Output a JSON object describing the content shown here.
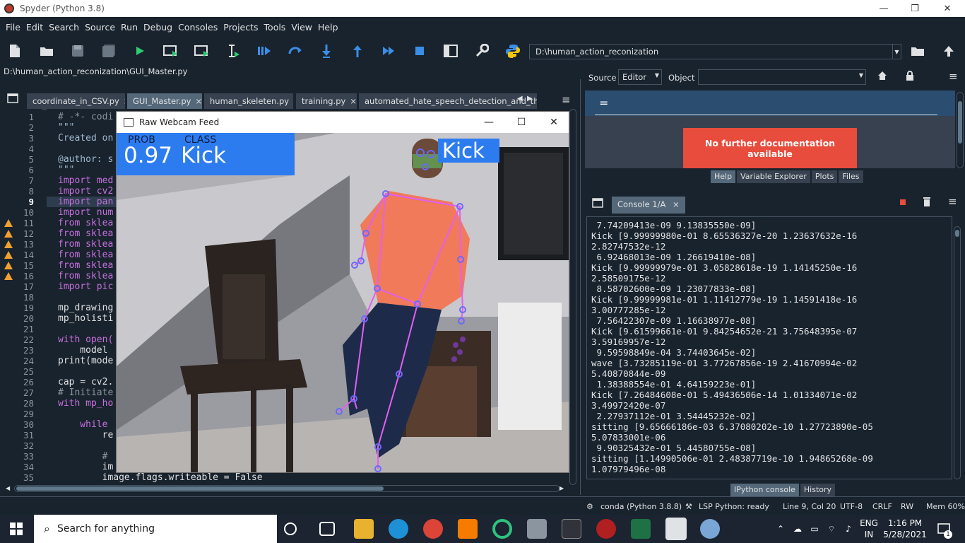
{
  "window": {
    "title": "Spyder (Python 3.8)"
  },
  "menu": [
    "File",
    "Edit",
    "Search",
    "Source",
    "Run",
    "Debug",
    "Consoles",
    "Projects",
    "Tools",
    "View",
    "Help"
  ],
  "toolbar": {
    "path_value": "D:\\human_action_reconization",
    "icons": [
      "new-file-icon",
      "open-folder-icon",
      "save-icon",
      "save-all-icon",
      "run-icon",
      "run-cell-icon",
      "run-cell-advance-icon",
      "run-selection-icon",
      "debug-icon",
      "step-icon",
      "step-into-icon",
      "step-return-icon",
      "continue-icon",
      "stop-icon",
      "maximize-pane-icon",
      "preferences-icon",
      "python-path-icon"
    ]
  },
  "editor": {
    "file_path": "D:\\human_action_reconization\\GUI_Master.py",
    "tabs": [
      {
        "label": "coordinate_in_CSV.py",
        "close": "×"
      },
      {
        "label": "GUI_Master.py",
        "close": "×"
      },
      {
        "label": "human_skeleten.py",
        "close": "×"
      },
      {
        "label": "training.py",
        "close": "×"
      },
      {
        "label": "automated_hate_speech_detection_and_the_prob",
        "close": ""
      }
    ],
    "line_numbers": [
      "1",
      "2",
      "3",
      "4",
      "5",
      "6",
      "7",
      "8",
      "9",
      "10",
      "11",
      "12",
      "13",
      "14",
      "15",
      "16",
      "17",
      "18",
      "19",
      "20",
      "21",
      "22",
      "23",
      "24",
      "25",
      "26",
      "27",
      "28",
      "29",
      "30",
      "31",
      "32",
      "33",
      "34",
      "35"
    ],
    "current_line": "9",
    "code_lines": [
      {
        "n": 1,
        "text": "# -*- codi",
        "color": "#8a95a0"
      },
      {
        "n": 2,
        "text": "\"\"\"",
        "color": "#9fb8cf"
      },
      {
        "n": 3,
        "text": "Created on",
        "color": "#9fb8cf"
      },
      {
        "n": 5,
        "text": "@author: s",
        "color": "#9fb8cf"
      },
      {
        "n": 6,
        "text": "\"\"\"",
        "color": "#9fb8cf"
      },
      {
        "n": 7,
        "text": "import med",
        "color": "#c670e0"
      },
      {
        "n": 8,
        "text": "import cv2",
        "color": "#c670e0"
      },
      {
        "n": 9,
        "text": "import pan",
        "color": "#c670e0"
      },
      {
        "n": 10,
        "text": "import num",
        "color": "#c670e0"
      },
      {
        "n": 11,
        "text": "from sklea",
        "color": "#c670e0"
      },
      {
        "n": 12,
        "text": "from sklea",
        "color": "#c670e0"
      },
      {
        "n": 13,
        "text": "from sklea",
        "color": "#c670e0"
      },
      {
        "n": 14,
        "text": "from sklea",
        "color": "#c670e0"
      },
      {
        "n": 15,
        "text": "from sklea",
        "color": "#c670e0"
      },
      {
        "n": 16,
        "text": "from sklea",
        "color": "#c670e0"
      },
      {
        "n": 17,
        "text": "import pic",
        "color": "#c670e0"
      },
      {
        "n": 19,
        "text": "mp_drawing",
        "color": "#e0e1e3"
      },
      {
        "n": 20,
        "text": "mp_holisti",
        "color": "#e0e1e3"
      },
      {
        "n": 22,
        "text": "with open(",
        "color": "#c670e0"
      },
      {
        "n": 23,
        "text": "    model ",
        "color": "#e0e1e3"
      },
      {
        "n": 24,
        "text": "print(mode",
        "color": "#e0e1e3"
      },
      {
        "n": 26,
        "text": "cap = cv2.",
        "color": "#e0e1e3"
      },
      {
        "n": 27,
        "text": "# Initiate",
        "color": "#8a95a0"
      },
      {
        "n": 28,
        "text": "with mp_ho",
        "color": "#c670e0"
      },
      {
        "n": 30,
        "text": "    while ",
        "color": "#c670e0"
      },
      {
        "n": 31,
        "text": "        re",
        "color": "#e0e1e3"
      },
      {
        "n": 33,
        "text": "        # ",
        "color": "#8a95a0"
      },
      {
        "n": 34,
        "text": "        im",
        "color": "#e0e1e3"
      },
      {
        "n": 35,
        "text": "        image.flags.writeable = False",
        "color": "#e0e1e3"
      }
    ],
    "warning_lines": [
      11,
      12,
      13,
      14,
      15,
      16
    ]
  },
  "webcam_window": {
    "title": "Raw Webcam Feed",
    "prob_label": "PROB",
    "class_label": "CLASS",
    "prob_value": "0.97",
    "class_value": "Kick",
    "detected_label": "Kick"
  },
  "help": {
    "source_label": "Source",
    "source_value": "Editor",
    "object_label": "Object",
    "object_value": "",
    "header": "=",
    "message": "No further documentation available",
    "tabs": [
      "Help",
      "Variable Explorer",
      "Plots",
      "Files"
    ]
  },
  "console": {
    "tab": "Console 1/A",
    "tab_close": "×",
    "lines": [
      " 7.74209413e-09 9.13835550e-09]",
      "Kick [9.99999980e-01 8.65536327e-20 1.23637632e-16",
      "2.82747532e-12",
      " 6.92468013e-09 1.26619410e-08]",
      "Kick [9.99999979e-01 3.05828618e-19 1.14145250e-16",
      "2.58509175e-12",
      " 8.58702600e-09 1.23077833e-08]",
      "Kick [9.99999981e-01 1.11412779e-19 1.14591418e-16",
      "3.00777285e-12",
      " 7.56422307e-09 1.16638977e-08]",
      "Kick [9.61599661e-01 9.84254652e-21 3.75648395e-07",
      "3.59169957e-12",
      " 9.59598849e-04 3.74403645e-02]",
      "wave [3.73285119e-01 3.77267856e-19 2.41670994e-02",
      "5.40870844e-09",
      " 1.38388554e-01 4.64159223e-01]",
      "Kick [7.26484608e-01 5.49436506e-14 1.01334071e-02",
      "3.49972420e-07",
      " 2.27937112e-01 3.54445232e-02]",
      "sitting [9.65666186e-03 6.37080202e-10 1.27723890e-05",
      "5.07833001e-06",
      " 9.90325432e-01 5.44580755e-08]",
      "sitting [1.14990506e-01 2.48387719e-10 1.94865268e-09",
      "1.07979496e-08"
    ],
    "bottom_tabs": [
      "IPython console",
      "History"
    ]
  },
  "status": {
    "env": "conda (Python 3.8.8)",
    "lsp": "LSP Python: ready",
    "position": "Line 9, Col 20",
    "encoding": "UTF-8",
    "eol": "CRLF",
    "mode": "RW",
    "memory": "Mem 60%"
  },
  "taskbar": {
    "search_placeholder": "Search for anything",
    "lang_top": "ENG",
    "lang_bottom": "IN",
    "time": "1:16 PM",
    "date": "5/28/2021",
    "notifications": "1"
  },
  "colors": {
    "accent": "#2c7cf0",
    "skeleton": "#e060f0",
    "joint": "#6a6af8",
    "error_red": "#e74c3c",
    "bg": "#19232d"
  }
}
